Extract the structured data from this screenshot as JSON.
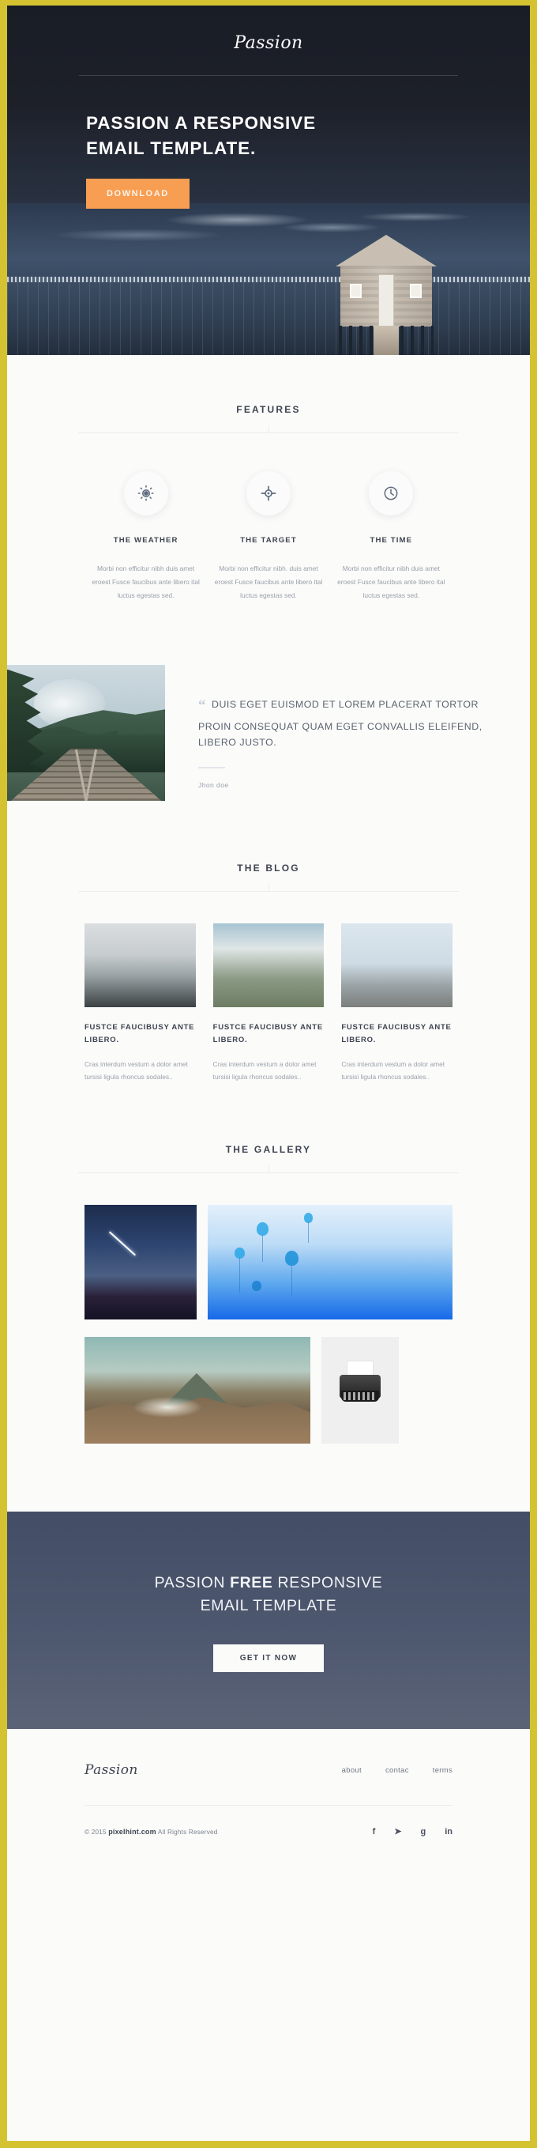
{
  "theme": {
    "border_yellow": "#d4c231",
    "hero_dark": "#1d222b",
    "accent_orange": "#f79e52",
    "cta_slate": "#4d576e",
    "heading_gray": "#3d434f",
    "body_gray": "#9aa0aa"
  },
  "hero": {
    "brand": "Passion",
    "title_line1": "PASSION  A RESPONSIVE",
    "title_line2": "EMAIL TEMPLATE.",
    "download_label": "DOWNLOAD"
  },
  "features": {
    "section_title": "FEATURES",
    "items": [
      {
        "icon": "sun-icon",
        "name": "THE WEATHER",
        "text": "Morbi non efficitur nibh duis amet eroest Fusce faucibus ante libero ital luctus egestas sed."
      },
      {
        "icon": "crosshair-icon",
        "name": "THE TARGET",
        "text": "Morbi non efficitur nibh. duis amet eroest Fusce faucibus ante libero ital luctus egestas sed."
      },
      {
        "icon": "clock-icon",
        "name": "THE TIME",
        "text": "Morbi non efficitur nibh duis amet eroest Fusce faucibus ante libero ital luctus egestas sed."
      }
    ]
  },
  "quote": {
    "mark": "“",
    "text": "DUIS EGET EUISMOD ET LOREM PLACERAT TORTOR PROIN CONSEQUAT QUAM EGET CONVALLIS ELEIFEND, LIBERO JUSTO.",
    "author": "Jhon doe",
    "photo_alt": "railway-tracks-forest-photo"
  },
  "blog": {
    "section_title": "THE BLOG",
    "posts": [
      {
        "thumb_alt": "foggy-sea-photo",
        "title": "FUSTCE FAUCIBUSY ANTE LIBERO.",
        "text": "Cras interdum vestum a dolor amet tursisi ligula rhoncus sodales.."
      },
      {
        "thumb_alt": "cliff-clouds-photo",
        "title": "FUSTCE FAUCIBUSY ANTE LIBERO.",
        "text": "Cras interdum vestum a dolor amet tursisi ligula rhoncus sodales.."
      },
      {
        "thumb_alt": "snowy-mountain-birds-photo",
        "title": "FUSTCE FAUCIBUSY ANTE LIBERO.",
        "text": "Cras interdum vestum a dolor amet tursisi ligula rhoncus sodales.."
      }
    ]
  },
  "gallery": {
    "section_title": "THE GALLERY",
    "images": [
      {
        "alt": "starry-night-sky-photo"
      },
      {
        "alt": "blue-jellyfish-photo"
      },
      {
        "alt": "volcano-mountain-photo"
      },
      {
        "alt": "typewriter-photo"
      }
    ]
  },
  "cta": {
    "title_pre": "PASSION ",
    "title_bold": "FREE",
    "title_post": " RESPONSIVE",
    "title_line2": "EMAIL TEMPLATE",
    "button_label": "GET IT NOW"
  },
  "footer": {
    "brand": "Passion",
    "links": [
      "about",
      "contac",
      "terms"
    ],
    "copyright_pre": "© 2015 ",
    "copyright_brand": "pixelhint.com",
    "copyright_post": " All Rights Reserved",
    "socials": [
      {
        "name": "facebook-icon",
        "glyph": "f"
      },
      {
        "name": "twitter-icon",
        "glyph": "➤"
      },
      {
        "name": "google-plus-icon",
        "glyph": "g"
      },
      {
        "name": "linkedin-icon",
        "glyph": "in"
      }
    ]
  }
}
